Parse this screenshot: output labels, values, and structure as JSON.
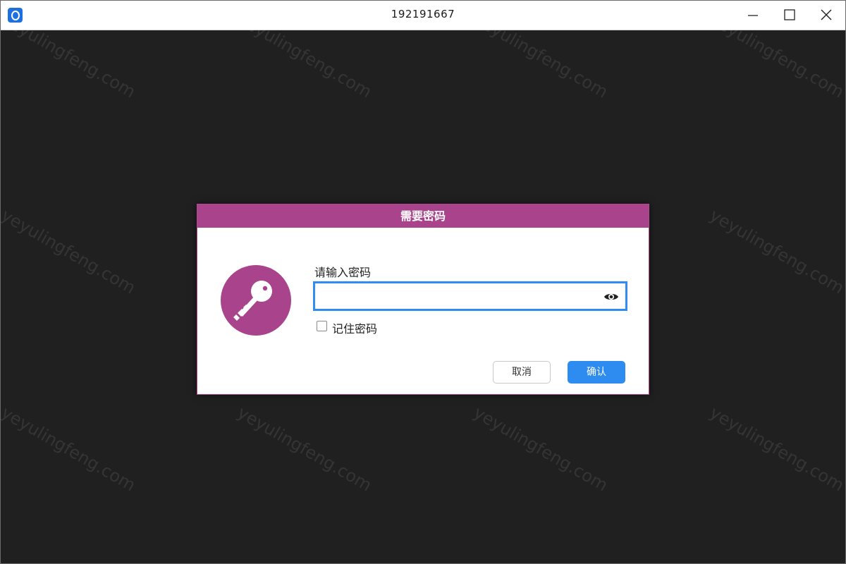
{
  "window": {
    "title": "192191667",
    "app_icon": "app-logo-icon",
    "controls": [
      "minimize-icon",
      "maximize-icon",
      "close-icon"
    ]
  },
  "watermark": {
    "text": "yeyulingfeng.com"
  },
  "dialog": {
    "title": "需要密码",
    "icon": "key-icon",
    "password_label": "请输入密码",
    "password_value": "",
    "password_placeholder": "",
    "show_password_icon": "eye-icon",
    "remember_label": "记住密码",
    "remember_checked": false,
    "cancel_label": "取消",
    "confirm_label": "确认"
  },
  "colors": {
    "background": "#202020",
    "accent": "#a9438b",
    "primary_button": "#2e8cf0",
    "input_focus_border": "#2f8cf0"
  }
}
